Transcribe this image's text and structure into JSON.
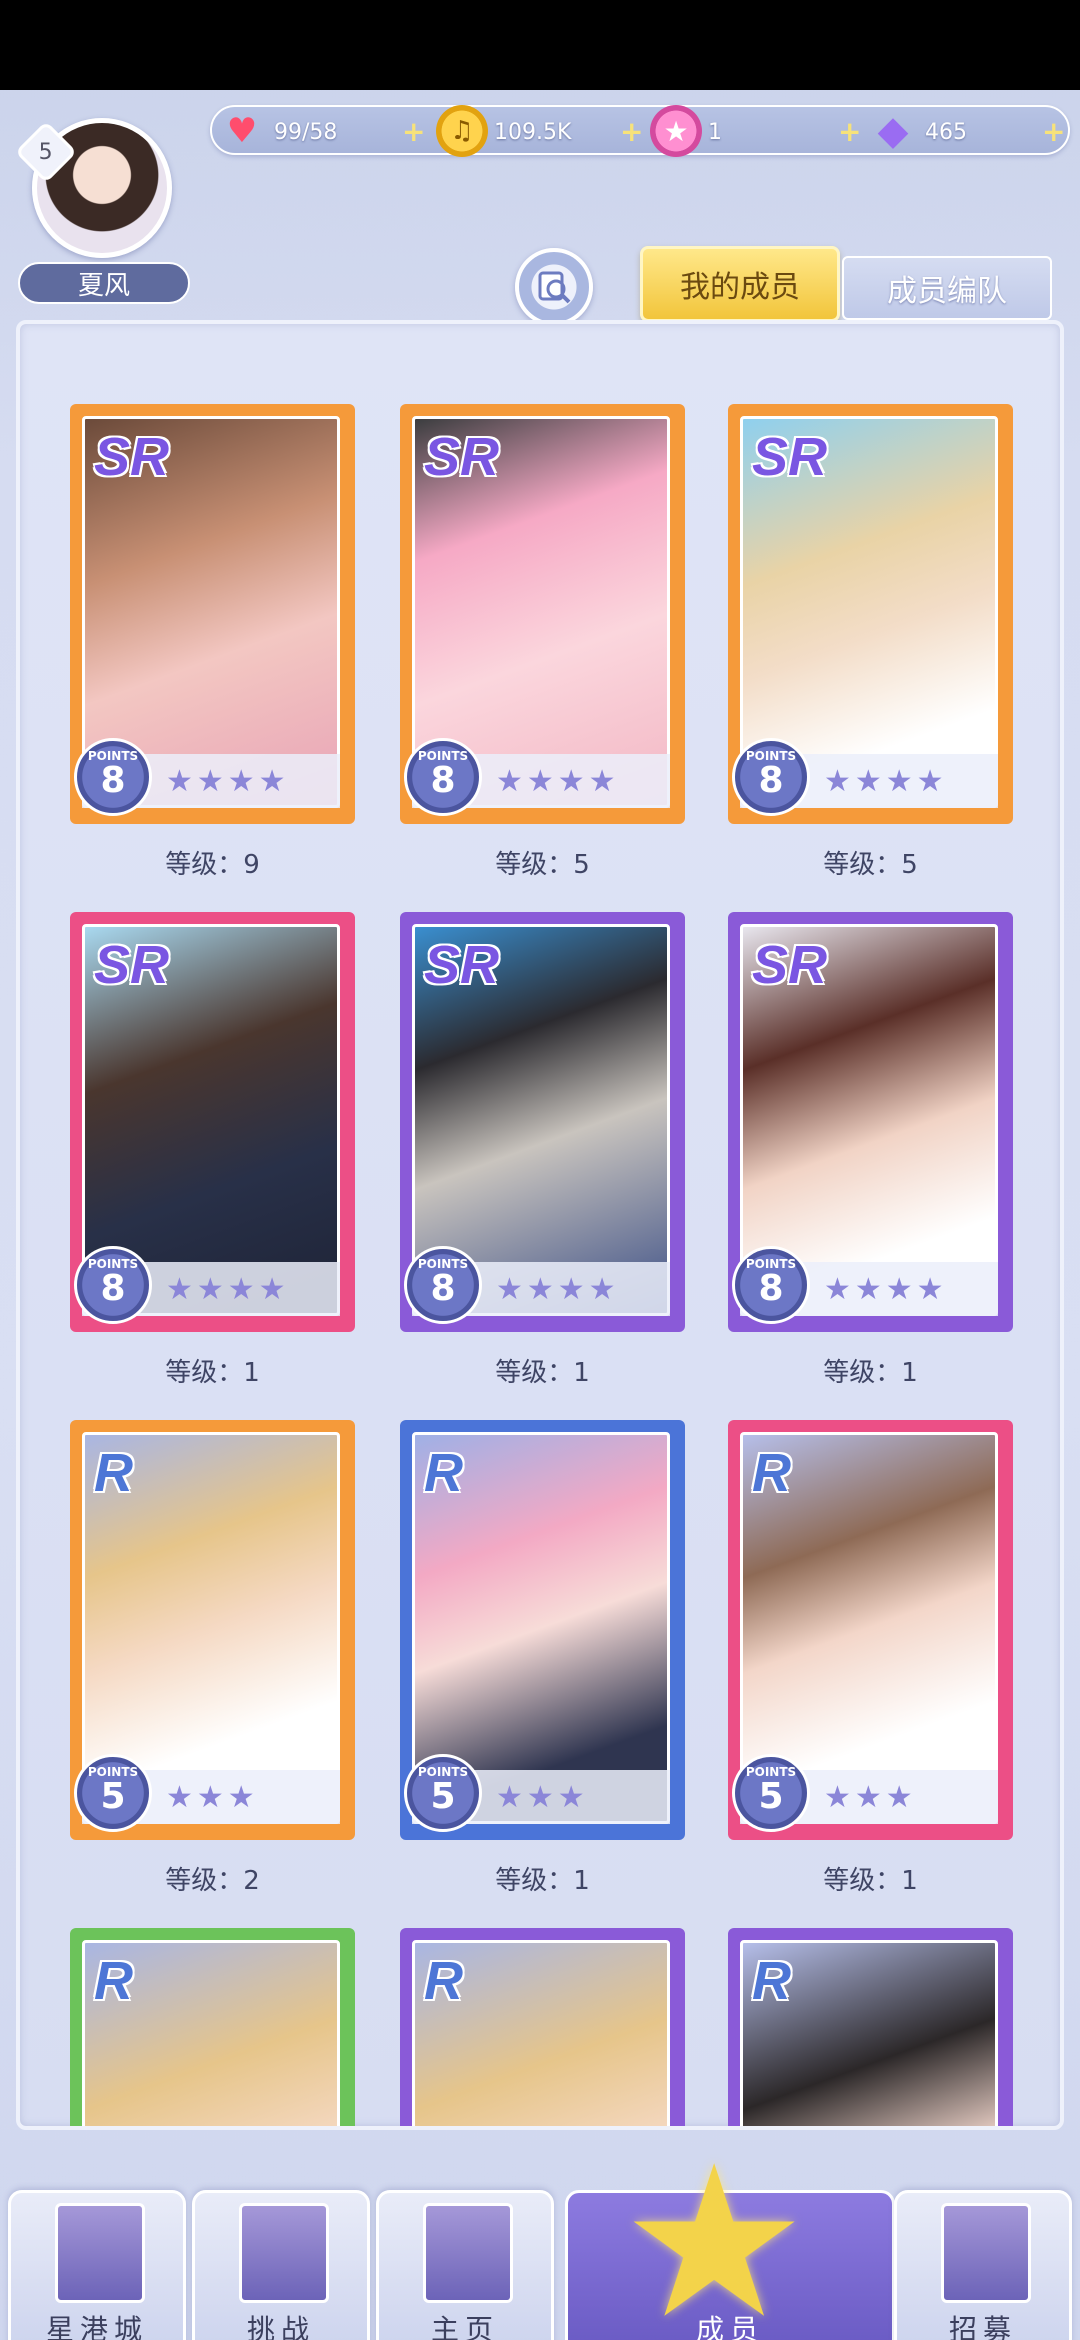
{
  "resources": {
    "stamina": "99/58",
    "gold": "109.5K",
    "star": "1",
    "diamond": "465"
  },
  "user": {
    "level": "5",
    "name": "夏风"
  },
  "tabs": {
    "my_members": "我的成员",
    "formation": "成员编队"
  },
  "cards": [
    {
      "rarity": "SR",
      "points": "8",
      "stars": "★★★★",
      "level": "等级：9"
    },
    {
      "rarity": "SR",
      "points": "8",
      "stars": "★★★★",
      "level": "等级：5"
    },
    {
      "rarity": "SR",
      "points": "8",
      "stars": "★★★★",
      "level": "等级：5"
    },
    {
      "rarity": "SR",
      "points": "8",
      "stars": "★★★★",
      "level": "等级：1"
    },
    {
      "rarity": "SR",
      "points": "8",
      "stars": "★★★★",
      "level": "等级：1"
    },
    {
      "rarity": "SR",
      "points": "8",
      "stars": "★★★★",
      "level": "等级：1"
    },
    {
      "rarity": "R",
      "points": "5",
      "stars": "★★★",
      "level": "等级：2"
    },
    {
      "rarity": "R",
      "points": "5",
      "stars": "★★★",
      "level": "等级：1"
    },
    {
      "rarity": "R",
      "points": "5",
      "stars": "★★★",
      "level": "等级：1"
    },
    {
      "rarity": "R",
      "points": "",
      "stars": "",
      "level": ""
    },
    {
      "rarity": "R",
      "points": "",
      "stars": "",
      "level": ""
    },
    {
      "rarity": "R",
      "points": "",
      "stars": "",
      "level": ""
    }
  ],
  "points_label": "POINTS",
  "nav": {
    "star_city": "星港城",
    "challenge": "挑战",
    "home": "主页",
    "members": "成员",
    "recruit": "招募"
  },
  "colors": {
    "frame_orange": "#f59a3a",
    "frame_pink": "#ec4f86",
    "frame_purple": "#8a5ad8",
    "frame_blue": "#4b74d8",
    "frame_green": "#6cc35a",
    "accent_gold": "#f2c53b"
  }
}
